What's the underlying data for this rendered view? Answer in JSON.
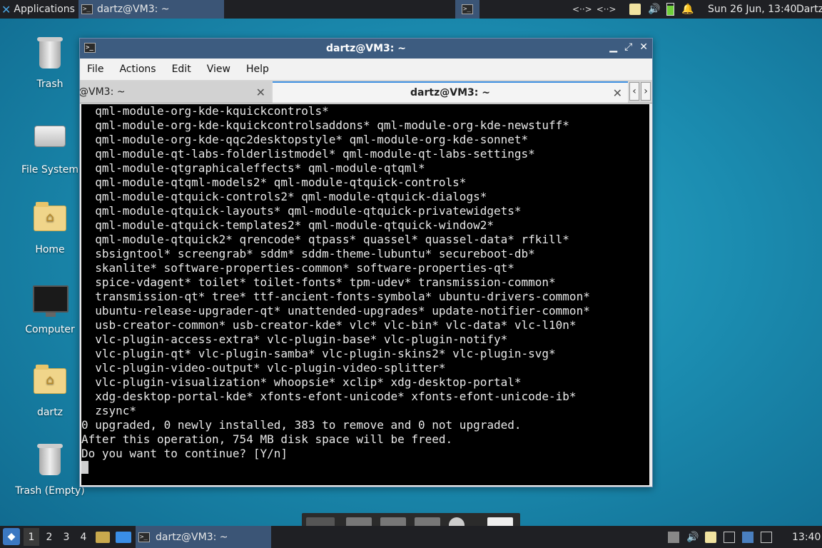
{
  "top_panel": {
    "apps_label": "Applications",
    "task_title": "dartz@VM3: ~",
    "net_label_1": "<··>",
    "net_label_2": "<··>",
    "clock": "Sun 26 Jun, 13:40",
    "user": "Dartz"
  },
  "desktop": {
    "icons": [
      {
        "label": "Trash",
        "icon": "trash-icon"
      },
      {
        "label": "File System",
        "icon": "drive-icon"
      },
      {
        "label": "Home",
        "icon": "home-folder-icon"
      },
      {
        "label": "Computer",
        "icon": "monitor-icon"
      },
      {
        "label": "dartz",
        "icon": "home-folder-icon"
      },
      {
        "label": "Trash (Empty)",
        "icon": "trash-icon"
      }
    ]
  },
  "window": {
    "title": "dartz@VM3: ~",
    "menu": [
      "File",
      "Actions",
      "Edit",
      "View",
      "Help"
    ],
    "tabs": [
      {
        "label": "@VM3: ~",
        "active": false
      },
      {
        "label": "dartz@VM3: ~",
        "active": true
      }
    ],
    "terminal_lines": [
      "  qml-module-org-kde-kquickcontrols*",
      "  qml-module-org-kde-kquickcontrolsaddons* qml-module-org-kde-newstuff*",
      "  qml-module-org-kde-qqc2desktopstyle* qml-module-org-kde-sonnet*",
      "  qml-module-qt-labs-folderlistmodel* qml-module-qt-labs-settings*",
      "  qml-module-qtgraphicaleffects* qml-module-qtqml*",
      "  qml-module-qtqml-models2* qml-module-qtquick-controls*",
      "  qml-module-qtquick-controls2* qml-module-qtquick-dialogs*",
      "  qml-module-qtquick-layouts* qml-module-qtquick-privatewidgets*",
      "  qml-module-qtquick-templates2* qml-module-qtquick-window2*",
      "  qml-module-qtquick2* qrencode* qtpass* quassel* quassel-data* rfkill*",
      "  sbsigntool* screengrab* sddm* sddm-theme-lubuntu* secureboot-db*",
      "  skanlite* software-properties-common* software-properties-qt*",
      "  spice-vdagent* toilet* toilet-fonts* tpm-udev* transmission-common*",
      "  transmission-qt* tree* ttf-ancient-fonts-symbola* ubuntu-drivers-common*",
      "  ubuntu-release-upgrader-qt* unattended-upgrades* update-notifier-common*",
      "  usb-creator-common* usb-creator-kde* vlc* vlc-bin* vlc-data* vlc-l10n*",
      "  vlc-plugin-access-extra* vlc-plugin-base* vlc-plugin-notify*",
      "  vlc-plugin-qt* vlc-plugin-samba* vlc-plugin-skins2* vlc-plugin-svg*",
      "  vlc-plugin-video-output* vlc-plugin-video-splitter*",
      "  vlc-plugin-visualization* whoopsie* xclip* xdg-desktop-portal*",
      "  xdg-desktop-portal-kde* xfonts-efont-unicode* xfonts-efont-unicode-ib*",
      "  zsync*",
      "0 upgraded, 0 newly installed, 383 to remove and 0 not upgraded.",
      "After this operation, 754 MB disk space will be freed.",
      "Do you want to continue? [Y/n]"
    ]
  },
  "bottom_panel": {
    "workspaces": [
      "1",
      "2",
      "3",
      "4"
    ],
    "task_title": "dartz@VM3: ~",
    "clock": "13:40"
  }
}
